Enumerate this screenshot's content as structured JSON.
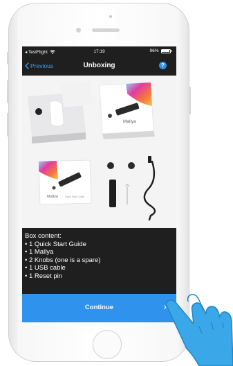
{
  "status_bar": {
    "carrier": "◂ TestFlight",
    "time": "17:19",
    "battery": "96%",
    "battery_level": 0.96
  },
  "nav": {
    "back_label": "Previous",
    "title": "Unboxing",
    "help_symbol": "?"
  },
  "photo": {
    "box_brand": "Mallya",
    "guide_title": "Quick Start Guide",
    "guide_brand": "Mallya"
  },
  "content": {
    "heading": "Box content:",
    "items": [
      "• 1 Quick Start Guide",
      "• 1 Mallya",
      "• 2 Knobs (one is a spare)",
      "• 1 USB cable",
      "• 1 Reset pin"
    ]
  },
  "continue": {
    "label": "Continue",
    "chevron": "›"
  },
  "colors": {
    "accent": "#2f93ee",
    "screen_bg": "#1f1f1f",
    "hand": "#3aa8e8"
  },
  "icons": [
    "wifi-icon",
    "battery-icon",
    "back-chevron-icon",
    "help-icon",
    "chevron-right-icon",
    "pointing-hand-icon"
  ]
}
